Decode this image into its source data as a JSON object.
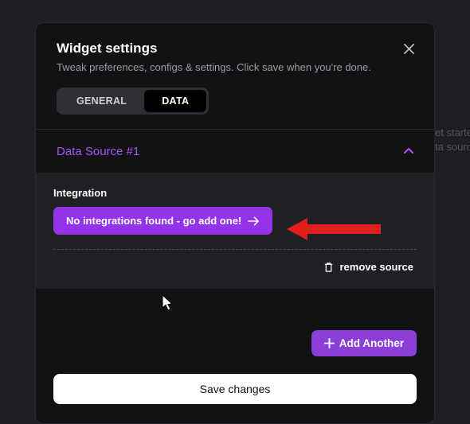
{
  "header": {
    "title": "Widget settings",
    "subtitle": "Tweak preferences, configs & settings. Click save when you're done."
  },
  "tabs": {
    "general": "GENERAL",
    "data": "DATA"
  },
  "accordion": {
    "title": "Data Source #1"
  },
  "integration": {
    "label": "Integration",
    "button": "No integrations found - go add one!"
  },
  "actions": {
    "remove": "remove source",
    "add": "Add Another",
    "save": "Save changes"
  },
  "background": {
    "line1": "et started",
    "line2": "ta source"
  },
  "colors": {
    "accent": "#9333ea",
    "accent_text": "#a855f7"
  }
}
